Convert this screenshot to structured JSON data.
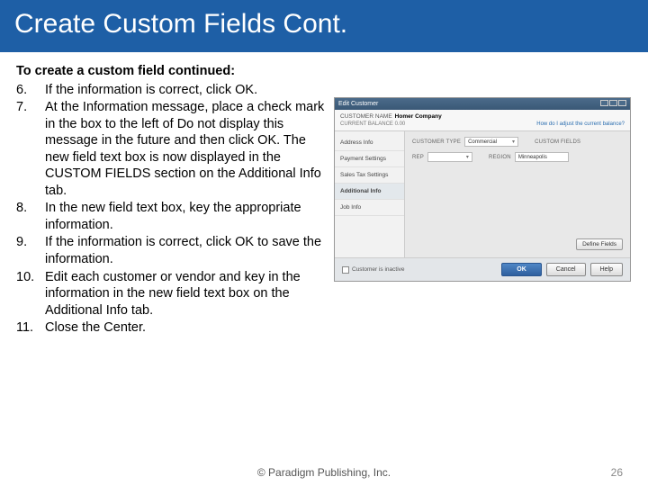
{
  "slide": {
    "title": "Create Custom Fields Cont.",
    "intro": "To create a custom field continued:",
    "steps": [
      {
        "num": "6.",
        "text": "If the information is correct, click OK."
      },
      {
        "num": "7.",
        "text": "At the Information message, place a check mark in the box to the left of Do not display this message in the future and then click OK. The new field text box is now displayed in the CUSTOM FIELDS section on the Additional Info tab."
      },
      {
        "num": "8.",
        "text": "In the new field text box, key the appropriate information."
      },
      {
        "num": "9.",
        "text": "If the information is correct, click OK to save the information."
      },
      {
        "num": "10.",
        "text": "Edit each customer or vendor and key in the information in the new field text box on the Additional Info tab."
      },
      {
        "num": "11.",
        "text": "Close the Center."
      }
    ],
    "copyright": "© Paradigm Publishing, Inc.",
    "page_number": "26"
  },
  "dialog": {
    "title": "Edit Customer",
    "customer_label": "CUSTOMER NAME",
    "customer_name": "Homer Company",
    "balance_label": "CURRENT BALANCE 0.00",
    "adjust_link": "How do I adjust the current balance?",
    "tabs": {
      "address": "Address Info",
      "payment": "Payment Settings",
      "tax": "Sales Tax Settings",
      "additional": "Additional Info",
      "job": "Job Info"
    },
    "panel": {
      "type_label": "CUSTOMER TYPE",
      "type_value": "Commercial",
      "rep_label": "REP",
      "cf_heading": "CUSTOM FIELDS",
      "region_label": "REGION",
      "region_value": "Minneapolis",
      "define_fields": "Define Fields"
    },
    "footer": {
      "inactive": "Customer is inactive",
      "ok": "OK",
      "cancel": "Cancel",
      "help": "Help"
    }
  }
}
